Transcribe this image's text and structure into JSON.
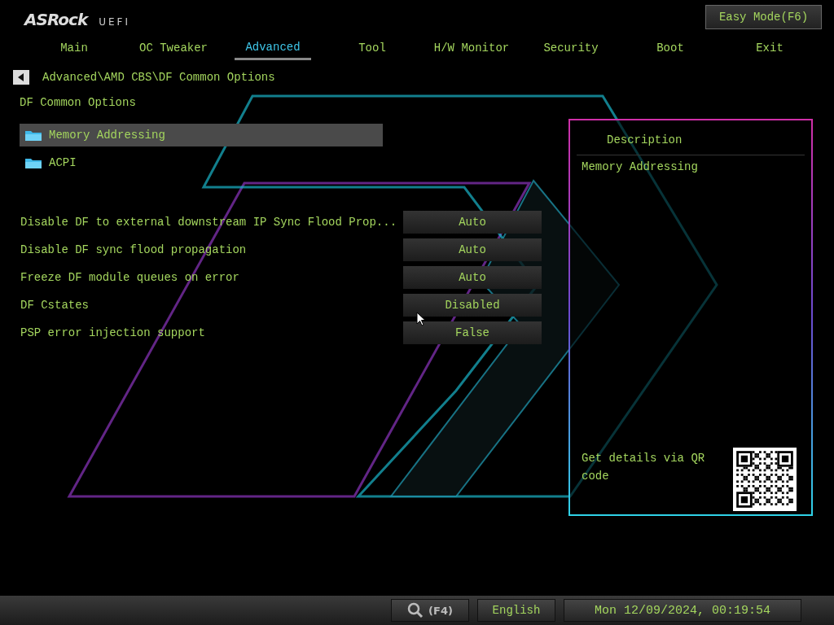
{
  "header": {
    "logo": "ASRock",
    "logo_suffix": "UEFI",
    "easy_mode_button": "Easy Mode(F6)"
  },
  "tabs": [
    {
      "label": "Main",
      "selected": false
    },
    {
      "label": "OC Tweaker",
      "selected": false
    },
    {
      "label": "Advanced",
      "selected": true
    },
    {
      "label": "Tool",
      "selected": false
    },
    {
      "label": "H/W Monitor",
      "selected": false
    },
    {
      "label": "Security",
      "selected": false
    },
    {
      "label": "Boot",
      "selected": false
    },
    {
      "label": "Exit",
      "selected": false
    }
  ],
  "breadcrumb": "Advanced\\AMD CBS\\DF Common Options",
  "page_title": "DF Common Options",
  "submenus": [
    {
      "label": "Memory Addressing",
      "selected": true
    },
    {
      "label": "ACPI",
      "selected": false
    }
  ],
  "settings": [
    {
      "label": "Disable DF to external downstream IP Sync Flood Prop...",
      "value": "Auto"
    },
    {
      "label": "Disable DF sync flood propagation",
      "value": "Auto"
    },
    {
      "label": "Freeze DF module queues on error",
      "value": "Auto"
    },
    {
      "label": "DF Cstates",
      "value": "Disabled"
    },
    {
      "label": "PSP error injection support",
      "value": "False"
    }
  ],
  "description": {
    "title": "Description",
    "text": "Memory Addressing",
    "qr_hint": "Get details via QR code"
  },
  "status_bar": {
    "search_key": "(F4)",
    "language": "English",
    "datetime": "Mon 12/09/2024, 00:19:54"
  }
}
